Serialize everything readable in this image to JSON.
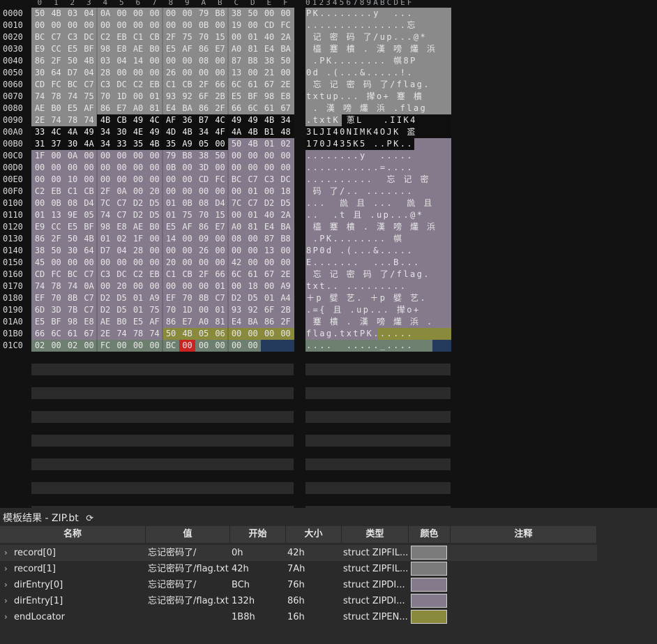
{
  "columns_hex": [
    "0",
    "1",
    "2",
    "3",
    "4",
    "5",
    "6",
    "7",
    "8",
    "9",
    "A",
    "B",
    "C",
    "D",
    "E",
    "F"
  ],
  "columns_text": "0123456789ABCDEF",
  "addresses": [
    "0000",
    "0010",
    "0020",
    "0030",
    "0040",
    "0050",
    "0060",
    "0070",
    "0080",
    "0090",
    "00A0",
    "00B0",
    "00C0",
    "00D0",
    "00E0",
    "00F0",
    "0100",
    "0110",
    "0120",
    "0130",
    "0140",
    "0150",
    "0160",
    "0170",
    "0180",
    "0190",
    "01A0",
    "01B0",
    "01C0"
  ],
  "hex_rows": [
    [
      "50",
      "4B",
      "03",
      "04",
      "0A",
      "00",
      "00",
      "00",
      "00",
      "00",
      "79",
      "B8",
      "38",
      "50",
      "00",
      "00"
    ],
    [
      "00",
      "00",
      "00",
      "00",
      "00",
      "00",
      "00",
      "00",
      "00",
      "00",
      "0B",
      "00",
      "19",
      "00",
      "CD",
      "FC"
    ],
    [
      "BC",
      "C7",
      "C3",
      "DC",
      "C2",
      "EB",
      "C1",
      "CB",
      "2F",
      "75",
      "70",
      "15",
      "00",
      "01",
      "40",
      "2A"
    ],
    [
      "E9",
      "CC",
      "E5",
      "BF",
      "98",
      "E8",
      "AE",
      "B0",
      "E5",
      "AF",
      "86",
      "E7",
      "A0",
      "81",
      "E4",
      "BA"
    ],
    [
      "86",
      "2F",
      "50",
      "4B",
      "03",
      "04",
      "14",
      "00",
      "00",
      "00",
      "08",
      "00",
      "87",
      "B8",
      "38",
      "50"
    ],
    [
      "30",
      "64",
      "D7",
      "04",
      "28",
      "00",
      "00",
      "00",
      "26",
      "00",
      "00",
      "00",
      "13",
      "00",
      "21",
      "00"
    ],
    [
      "CD",
      "FC",
      "BC",
      "C7",
      "C3",
      "DC",
      "C2",
      "EB",
      "C1",
      "CB",
      "2F",
      "66",
      "6C",
      "61",
      "67",
      "2E"
    ],
    [
      "74",
      "78",
      "74",
      "75",
      "70",
      "1D",
      "00",
      "01",
      "93",
      "92",
      "6F",
      "2B",
      "E5",
      "BF",
      "98",
      "E8"
    ],
    [
      "AE",
      "B0",
      "E5",
      "AF",
      "86",
      "E7",
      "A0",
      "81",
      "E4",
      "BA",
      "86",
      "2F",
      "66",
      "6C",
      "61",
      "67"
    ],
    [
      "2E",
      "74",
      "78",
      "74",
      "4B",
      "CB",
      "49",
      "4C",
      "AF",
      "36",
      "B7",
      "4C",
      "49",
      "49",
      "4B",
      "34"
    ],
    [
      "33",
      "4C",
      "4A",
      "49",
      "34",
      "30",
      "4E",
      "49",
      "4D",
      "4B",
      "34",
      "4F",
      "4A",
      "4B",
      "B1",
      "48"
    ],
    [
      "31",
      "37",
      "30",
      "4A",
      "34",
      "33",
      "35",
      "4B",
      "35",
      "A9",
      "05",
      "00",
      "50",
      "4B",
      "01",
      "02"
    ],
    [
      "1F",
      "00",
      "0A",
      "00",
      "00",
      "00",
      "00",
      "00",
      "79",
      "B8",
      "38",
      "50",
      "00",
      "00",
      "00",
      "00"
    ],
    [
      "00",
      "00",
      "00",
      "00",
      "00",
      "00",
      "00",
      "00",
      "0B",
      "00",
      "3D",
      "00",
      "00",
      "00",
      "00",
      "00"
    ],
    [
      "00",
      "00",
      "10",
      "00",
      "00",
      "00",
      "00",
      "00",
      "00",
      "00",
      "CD",
      "FC",
      "BC",
      "C7",
      "C3",
      "DC"
    ],
    [
      "C2",
      "EB",
      "C1",
      "CB",
      "2F",
      "0A",
      "00",
      "20",
      "00",
      "00",
      "00",
      "00",
      "00",
      "01",
      "00",
      "18"
    ],
    [
      "00",
      "0B",
      "08",
      "D4",
      "7C",
      "C7",
      "D2",
      "D5",
      "01",
      "0B",
      "08",
      "D4",
      "7C",
      "C7",
      "D2",
      "D5"
    ],
    [
      "01",
      "13",
      "9E",
      "05",
      "74",
      "C7",
      "D2",
      "D5",
      "01",
      "75",
      "70",
      "15",
      "00",
      "01",
      "40",
      "2A"
    ],
    [
      "E9",
      "CC",
      "E5",
      "BF",
      "98",
      "E8",
      "AE",
      "B0",
      "E5",
      "AF",
      "86",
      "E7",
      "A0",
      "81",
      "E4",
      "BA"
    ],
    [
      "86",
      "2F",
      "50",
      "4B",
      "01",
      "02",
      "1F",
      "00",
      "14",
      "00",
      "09",
      "00",
      "08",
      "00",
      "87",
      "B8"
    ],
    [
      "38",
      "50",
      "30",
      "64",
      "D7",
      "04",
      "28",
      "00",
      "00",
      "00",
      "26",
      "00",
      "00",
      "00",
      "13",
      "00"
    ],
    [
      "45",
      "00",
      "00",
      "00",
      "00",
      "00",
      "00",
      "00",
      "20",
      "00",
      "00",
      "00",
      "42",
      "00",
      "00",
      "00"
    ],
    [
      "CD",
      "FC",
      "BC",
      "C7",
      "C3",
      "DC",
      "C2",
      "EB",
      "C1",
      "CB",
      "2F",
      "66",
      "6C",
      "61",
      "67",
      "2E"
    ],
    [
      "74",
      "78",
      "74",
      "0A",
      "00",
      "20",
      "00",
      "00",
      "00",
      "00",
      "00",
      "01",
      "00",
      "18",
      "00",
      "A9"
    ],
    [
      "EF",
      "70",
      "8B",
      "C7",
      "D2",
      "D5",
      "01",
      "A9",
      "EF",
      "70",
      "8B",
      "C7",
      "D2",
      "D5",
      "01",
      "A4"
    ],
    [
      "6D",
      "3D",
      "7B",
      "C7",
      "D2",
      "D5",
      "01",
      "75",
      "70",
      "1D",
      "00",
      "01",
      "93",
      "92",
      "6F",
      "2B"
    ],
    [
      "E5",
      "BF",
      "98",
      "E8",
      "AE",
      "B0",
      "E5",
      "AF",
      "86",
      "E7",
      "A0",
      "81",
      "E4",
      "BA",
      "86",
      "2F"
    ],
    [
      "66",
      "6C",
      "61",
      "67",
      "2E",
      "74",
      "78",
      "74",
      "50",
      "4B",
      "05",
      "06",
      "00",
      "00",
      "00",
      "00"
    ],
    [
      "02",
      "00",
      "02",
      "00",
      "FC",
      "00",
      "00",
      "00",
      "BC",
      "00",
      "00",
      "00",
      "00",
      "00",
      "",
      ""
    ]
  ],
  "text_rows": [
    "PK........y  ...",
    "...............忘",
    " 记 密 码 了/up...@*",
    " 橀 蹇 樻 . 漢 嗙 爜 浜",
    " .PK........ 帺8P",
    "0d .(...&.....!.",
    " 忘 记 密 码 了/flag.",
    "txtup... 撵o+ 蹇 樻",
    " . 漢 嗙 爜 浜 .flag",
    ".txtK 蔥L   .IIK4",
    "3LJI40NIMK4OJK 盚",
    "170J435K5 ..PK..",
    "........y  .....",
    "...........=....",
    "..........  忘 记 密",
    " 码 了/.. .......",
    "...  詤 且 ...  詤 且",
    "..  .t 且 .up...@*",
    " 橀 蹇 樻 . 漢 嗙 爜 浜",
    " .PK........ 帺",
    "8P0d .(...&.....",
    "E.......  ...B...",
    " 忘 记 密 码 了/flag.",
    "txt.. .........",
    "＋p 嬖 艺. ＋p 嬖 艺.",
    ".={ 且 .up... 撵o+",
    " 蹇 樻 . 漢 嗙 爜 浜 .",
    "flag.txtPK......",
    "....  ....._...."
  ],
  "colors": {
    "record": "#8a8a8a",
    "dir": "#857a8c",
    "end": "#8a8a3c",
    "ext": "#6d8070",
    "selected": "#0f0f0f",
    "cursor": "#cc2222",
    "tail": "#233a5c"
  },
  "template_panel": {
    "title": "模板结果 - ZIP.bt",
    "refresh_icon": "refresh-icon",
    "headers": [
      "名称",
      "值",
      "开始",
      "大小",
      "类型",
      "颜色",
      "注释"
    ],
    "rows": [
      {
        "name": "record[0]",
        "value": "忘记密码了/",
        "start": "0h",
        "size": "42h",
        "type": "struct ZIPFIL...",
        "color": "#7b7b7b",
        "comment": ""
      },
      {
        "name": "record[1]",
        "value": "忘记密码了/flag.txt",
        "start": "42h",
        "size": "7Ah",
        "type": "struct ZIPFIL...",
        "color": "#7b7b7b",
        "comment": ""
      },
      {
        "name": "dirEntry[0]",
        "value": "忘记密码了/",
        "start": "BCh",
        "size": "76h",
        "type": "struct ZIPDI...",
        "color": "#857a8c",
        "comment": ""
      },
      {
        "name": "dirEntry[1]",
        "value": "忘记密码了/flag.txt",
        "start": "132h",
        "size": "86h",
        "type": "struct ZIPDI...",
        "color": "#857a8c",
        "comment": ""
      },
      {
        "name": "endLocator",
        "value": "",
        "start": "1B8h",
        "size": "16h",
        "type": "struct ZIPEN...",
        "color": "#8a8a3c",
        "comment": ""
      }
    ]
  }
}
